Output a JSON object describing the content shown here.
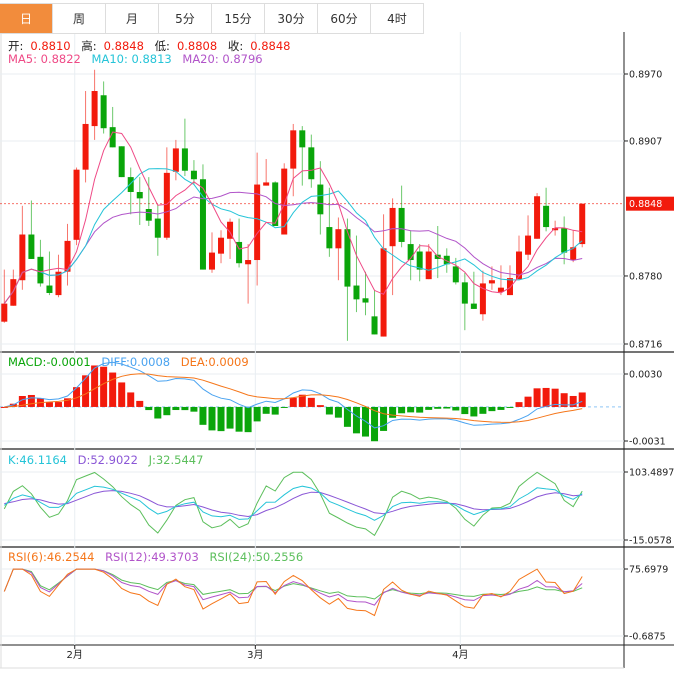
{
  "tabs": [
    {
      "label": "日",
      "active": true
    },
    {
      "label": "周"
    },
    {
      "label": "月"
    },
    {
      "label": "5分"
    },
    {
      "label": "15分"
    },
    {
      "label": "30分"
    },
    {
      "label": "60分"
    },
    {
      "label": "4时"
    }
  ],
  "ohlc_legend": {
    "open_label": "开:",
    "open": "0.8810",
    "high_label": "高:",
    "high": "0.8848",
    "low_label": "低:",
    "low": "0.8808",
    "close_label": "收:",
    "close": "0.8848"
  },
  "ma_legend": {
    "ma5": "MA5: 0.8822",
    "ma10": "MA10: 0.8813",
    "ma20": "MA20: 0.8796"
  },
  "macd_legend": {
    "macd": "MACD:-0.0001",
    "diff": "DIFF:0.0008",
    "dea": "DEA:0.0009"
  },
  "kdj_legend": {
    "k": "K:46.1164",
    "d": "D:52.9022",
    "j": "J:32.5447"
  },
  "rsi_legend": {
    "rsi6": "RSI(6):46.2544",
    "rsi12": "RSI(12):49.3703",
    "rsi24": "RSI(24):50.2556"
  },
  "current_price": "0.8848",
  "colors": {
    "up": "#f21a0c",
    "down": "#0aa50a",
    "ma5": "#ef4a86",
    "ma10": "#25c4d8",
    "ma20": "#b154c9",
    "accent": "#f28c3c",
    "diff": "#4aa3f0",
    "dea": "#f5761a",
    "k": "#25c4d8",
    "d": "#8a56d6",
    "j": "#5cbf5c",
    "rsi6": "#f5761a",
    "rsi12": "#b154c9",
    "rsi24": "#5cbf5c"
  },
  "chart_data": {
    "type": "candlestick",
    "price_axis": {
      "ticks": [
        "0.8970",
        "0.8907",
        "0.8780",
        "0.8716"
      ],
      "range": [
        0.8716,
        0.897
      ]
    },
    "x_ticks": [
      {
        "label": "2月",
        "index": 7.8
      },
      {
        "label": "3月",
        "index": 27.8
      },
      {
        "label": "4月",
        "index": 50.5
      }
    ],
    "candles": [
      [
        0.8737,
        0.8786,
        0.8736,
        0.8754
      ],
      [
        0.8752,
        0.8786,
        0.8752,
        0.8777
      ],
      [
        0.8776,
        0.8846,
        0.8767,
        0.8819
      ],
      [
        0.8819,
        0.8851,
        0.8796,
        0.8796
      ],
      [
        0.8798,
        0.8814,
        0.877,
        0.8773
      ],
      [
        0.8771,
        0.8803,
        0.8762,
        0.8764
      ],
      [
        0.8762,
        0.88,
        0.876,
        0.8784
      ],
      [
        0.8784,
        0.8829,
        0.8771,
        0.8813
      ],
      [
        0.8814,
        0.8882,
        0.8809,
        0.888
      ],
      [
        0.888,
        0.8954,
        0.8868,
        0.8923
      ],
      [
        0.8921,
        0.8974,
        0.8908,
        0.8954
      ],
      [
        0.895,
        0.8963,
        0.8914,
        0.8919
      ],
      [
        0.892,
        0.8939,
        0.8901,
        0.8901
      ],
      [
        0.8902,
        0.8902,
        0.8873,
        0.8873
      ],
      [
        0.8873,
        0.8882,
        0.8838,
        0.8859
      ],
      [
        0.8859,
        0.8873,
        0.8828,
        0.8853
      ],
      [
        0.8843,
        0.8873,
        0.8827,
        0.8832
      ],
      [
        0.8834,
        0.8847,
        0.8799,
        0.8816
      ],
      [
        0.8816,
        0.8901,
        0.8814,
        0.8877
      ],
      [
        0.8878,
        0.8908,
        0.887,
        0.89
      ],
      [
        0.89,
        0.8928,
        0.8874,
        0.8879
      ],
      [
        0.8879,
        0.8889,
        0.8866,
        0.8871
      ],
      [
        0.8871,
        0.8885,
        0.8786,
        0.8786
      ],
      [
        0.8786,
        0.8821,
        0.8783,
        0.8802
      ],
      [
        0.8801,
        0.8823,
        0.8792,
        0.8816
      ],
      [
        0.8815,
        0.8834,
        0.8796,
        0.8831
      ],
      [
        0.8812,
        0.8834,
        0.8788,
        0.8792
      ],
      [
        0.8791,
        0.881,
        0.8754,
        0.8795
      ],
      [
        0.8795,
        0.8896,
        0.8771,
        0.8866
      ],
      [
        0.8865,
        0.889,
        0.8865,
        0.8868
      ],
      [
        0.8868,
        0.8869,
        0.8827,
        0.8827
      ],
      [
        0.8819,
        0.8886,
        0.8819,
        0.8881
      ],
      [
        0.8881,
        0.8923,
        0.8855,
        0.8917
      ],
      [
        0.8917,
        0.8921,
        0.8865,
        0.8901
      ],
      [
        0.8901,
        0.8913,
        0.8863,
        0.8871
      ],
      [
        0.8866,
        0.8888,
        0.8819,
        0.8838
      ],
      [
        0.8826,
        0.8863,
        0.8798,
        0.8806
      ],
      [
        0.8806,
        0.8835,
        0.8776,
        0.8824
      ],
      [
        0.8824,
        0.8834,
        0.8719,
        0.877
      ],
      [
        0.8771,
        0.8818,
        0.8746,
        0.8758
      ],
      [
        0.8759,
        0.8784,
        0.8743,
        0.8755
      ],
      [
        0.8742,
        0.8767,
        0.8725,
        0.8725
      ],
      [
        0.8723,
        0.8838,
        0.8723,
        0.8806
      ],
      [
        0.8808,
        0.8853,
        0.8762,
        0.8844
      ],
      [
        0.8844,
        0.8865,
        0.8807,
        0.8812
      ],
      [
        0.881,
        0.8823,
        0.8776,
        0.8795
      ],
      [
        0.8803,
        0.881,
        0.8775,
        0.8786
      ],
      [
        0.8777,
        0.881,
        0.8777,
        0.8803
      ],
      [
        0.88,
        0.8827,
        0.8778,
        0.8796
      ],
      [
        0.8799,
        0.8806,
        0.8783,
        0.8791
      ],
      [
        0.8789,
        0.8797,
        0.8772,
        0.8774
      ],
      [
        0.8774,
        0.8783,
        0.8729,
        0.8754
      ],
      [
        0.8754,
        0.8784,
        0.8749,
        0.8749
      ],
      [
        0.8744,
        0.8785,
        0.8738,
        0.8773
      ],
      [
        0.8773,
        0.8789,
        0.8767,
        0.8776
      ],
      [
        0.8765,
        0.879,
        0.8762,
        0.8769
      ],
      [
        0.8762,
        0.879,
        0.8762,
        0.8778
      ],
      [
        0.8777,
        0.8818,
        0.8776,
        0.8803
      ],
      [
        0.88,
        0.8837,
        0.8795,
        0.8818
      ],
      [
        0.8815,
        0.8858,
        0.8815,
        0.8855
      ],
      [
        0.8846,
        0.8863,
        0.8822,
        0.8826
      ],
      [
        0.8823,
        0.8832,
        0.8818,
        0.8825
      ],
      [
        0.8825,
        0.8836,
        0.8791,
        0.8802
      ],
      [
        0.8795,
        0.8823,
        0.8793,
        0.8807
      ],
      [
        0.881,
        0.8848,
        0.8807,
        0.8848
      ]
    ],
    "macd_axis": {
      "ticks": [
        "0.0030",
        "-0.0031"
      ],
      "range": [
        -0.0031,
        0.003
      ]
    },
    "kdj_axis": {
      "ticks": [
        "103.4897",
        "-15.0578"
      ],
      "range": [
        -15.0578,
        103.4897
      ]
    },
    "rsi_axis": {
      "ticks": [
        "75.6979",
        "-0.6875"
      ],
      "range": [
        -0.6875,
        75.6979
      ]
    }
  }
}
